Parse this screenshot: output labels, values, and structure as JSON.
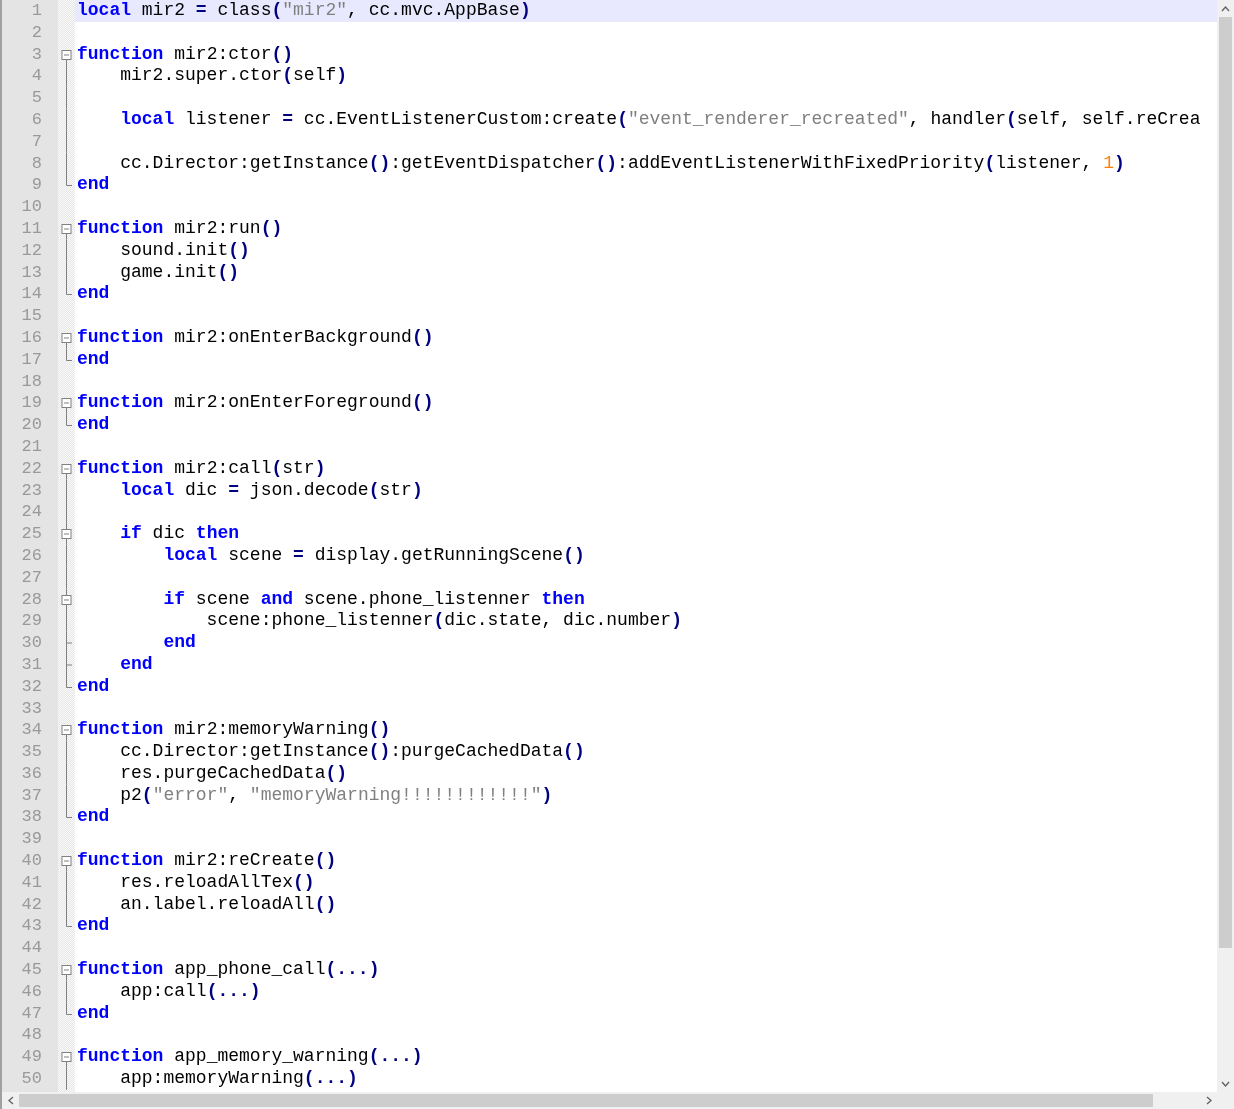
{
  "editor": {
    "lines": [
      {
        "number": "1",
        "kind": "plain",
        "current": true,
        "tokens": [
          {
            "kind": "keyword",
            "text": "local"
          },
          {
            "kind": "plain",
            "text": " mir2 "
          },
          {
            "kind": "operator",
            "text": "="
          },
          {
            "kind": "plain",
            "text": " class"
          },
          {
            "kind": "operator",
            "text": "("
          },
          {
            "kind": "string",
            "text": "\"mir2\""
          },
          {
            "kind": "plain",
            "text": ", cc.mvc.AppBase"
          },
          {
            "kind": "operator",
            "text": ")"
          }
        ]
      },
      {
        "number": "2",
        "kind": "plain",
        "current": false
      },
      {
        "number": "3",
        "kind": "fold-start",
        "current": false,
        "tokens": [
          {
            "kind": "keyword",
            "text": "function"
          },
          {
            "kind": "plain",
            "text": " mir2:ctor"
          },
          {
            "kind": "operator",
            "text": "()"
          }
        ]
      },
      {
        "number": "4",
        "kind": "fold-body",
        "current": false,
        "tokens": [
          {
            "kind": "plain",
            "text": "    mir2.super.ctor"
          },
          {
            "kind": "operator",
            "text": "("
          },
          {
            "kind": "plain",
            "text": "self"
          },
          {
            "kind": "operator",
            "text": ")"
          }
        ]
      },
      {
        "number": "5",
        "kind": "fold-body",
        "current": false
      },
      {
        "number": "6",
        "kind": "fold-body",
        "current": false,
        "tokens": [
          {
            "kind": "keyword",
            "text": "    local"
          },
          {
            "kind": "plain",
            "text": " listener "
          },
          {
            "kind": "operator",
            "text": "="
          },
          {
            "kind": "plain",
            "text": " cc.EventListenerCustom:create"
          },
          {
            "kind": "operator",
            "text": "("
          },
          {
            "kind": "string",
            "text": "\"event_renderer_recreated\""
          },
          {
            "kind": "plain",
            "text": ", handler"
          },
          {
            "kind": "operator",
            "text": "("
          },
          {
            "kind": "plain",
            "text": "self, self.reCrea"
          }
        ]
      },
      {
        "number": "7",
        "kind": "fold-body",
        "current": false
      },
      {
        "number": "8",
        "kind": "fold-body",
        "current": false,
        "tokens": [
          {
            "kind": "plain",
            "text": "    cc.Director:getInstance"
          },
          {
            "kind": "operator",
            "text": "()"
          },
          {
            "kind": "plain",
            "text": ":getEventDispatcher"
          },
          {
            "kind": "operator",
            "text": "()"
          },
          {
            "kind": "plain",
            "text": ":addEventListenerWithFixedPriority"
          },
          {
            "kind": "operator",
            "text": "("
          },
          {
            "kind": "plain",
            "text": "listener, "
          },
          {
            "kind": "number",
            "text": "1"
          },
          {
            "kind": "operator",
            "text": ")"
          }
        ]
      },
      {
        "number": "9",
        "kind": "fold-end",
        "current": false,
        "tokens": [
          {
            "kind": "keyword",
            "text": "end"
          }
        ]
      },
      {
        "number": "10",
        "kind": "plain",
        "current": false
      },
      {
        "number": "11",
        "kind": "fold-start",
        "current": false,
        "tokens": [
          {
            "kind": "keyword",
            "text": "function"
          },
          {
            "kind": "plain",
            "text": " mir2:run"
          },
          {
            "kind": "operator",
            "text": "()"
          }
        ]
      },
      {
        "number": "12",
        "kind": "fold-body",
        "current": false,
        "tokens": [
          {
            "kind": "plain",
            "text": "    sound.init"
          },
          {
            "kind": "operator",
            "text": "()"
          }
        ]
      },
      {
        "number": "13",
        "kind": "fold-body",
        "current": false,
        "tokens": [
          {
            "kind": "plain",
            "text": "    game.init"
          },
          {
            "kind": "operator",
            "text": "()"
          }
        ]
      },
      {
        "number": "14",
        "kind": "fold-end",
        "current": false,
        "tokens": [
          {
            "kind": "keyword",
            "text": "end"
          }
        ]
      },
      {
        "number": "15",
        "kind": "plain",
        "current": false
      },
      {
        "number": "16",
        "kind": "fold-start",
        "current": false,
        "tokens": [
          {
            "kind": "keyword",
            "text": "function"
          },
          {
            "kind": "plain",
            "text": " mir2:onEnterBackground"
          },
          {
            "kind": "operator",
            "text": "()"
          }
        ]
      },
      {
        "number": "17",
        "kind": "fold-end",
        "current": false,
        "tokens": [
          {
            "kind": "keyword",
            "text": "end"
          }
        ]
      },
      {
        "number": "18",
        "kind": "plain",
        "current": false
      },
      {
        "number": "19",
        "kind": "fold-start",
        "current": false,
        "tokens": [
          {
            "kind": "keyword",
            "text": "function"
          },
          {
            "kind": "plain",
            "text": " mir2:onEnterForeground"
          },
          {
            "kind": "operator",
            "text": "()"
          }
        ]
      },
      {
        "number": "20",
        "kind": "fold-end",
        "current": false,
        "tokens": [
          {
            "kind": "keyword",
            "text": "end"
          }
        ]
      },
      {
        "number": "21",
        "kind": "plain",
        "current": false
      },
      {
        "number": "22",
        "kind": "fold-start",
        "current": false,
        "tokens": [
          {
            "kind": "keyword",
            "text": "function"
          },
          {
            "kind": "plain",
            "text": " mir2:call"
          },
          {
            "kind": "operator",
            "text": "("
          },
          {
            "kind": "plain",
            "text": "str"
          },
          {
            "kind": "operator",
            "text": ")"
          }
        ]
      },
      {
        "number": "23",
        "kind": "fold-body",
        "current": false,
        "tokens": [
          {
            "kind": "keyword",
            "text": "    local"
          },
          {
            "kind": "plain",
            "text": " dic "
          },
          {
            "kind": "operator",
            "text": "="
          },
          {
            "kind": "plain",
            "text": " json.decode"
          },
          {
            "kind": "operator",
            "text": "("
          },
          {
            "kind": "plain",
            "text": "str"
          },
          {
            "kind": "operator",
            "text": ")"
          }
        ]
      },
      {
        "number": "24",
        "kind": "fold-body",
        "current": false
      },
      {
        "number": "25",
        "kind": "nested-fold-start",
        "current": false,
        "tokens": [
          {
            "kind": "keyword",
            "text": "    if"
          },
          {
            "kind": "plain",
            "text": " dic "
          },
          {
            "kind": "keyword",
            "text": "then"
          }
        ]
      },
      {
        "number": "26",
        "kind": "fold-body",
        "current": false,
        "tokens": [
          {
            "kind": "keyword",
            "text": "        local"
          },
          {
            "kind": "plain",
            "text": " scene "
          },
          {
            "kind": "operator",
            "text": "="
          },
          {
            "kind": "plain",
            "text": " display.getRunningScene"
          },
          {
            "kind": "operator",
            "text": "()"
          }
        ]
      },
      {
        "number": "27",
        "kind": "fold-body",
        "current": false
      },
      {
        "number": "28",
        "kind": "nested-fold-start",
        "current": false,
        "tokens": [
          {
            "kind": "keyword",
            "text": "        if"
          },
          {
            "kind": "plain",
            "text": " scene "
          },
          {
            "kind": "keyword",
            "text": "and"
          },
          {
            "kind": "plain",
            "text": " scene.phone_listenner "
          },
          {
            "kind": "keyword",
            "text": "then"
          }
        ]
      },
      {
        "number": "29",
        "kind": "fold-body",
        "current": false,
        "tokens": [
          {
            "kind": "plain",
            "text": "            scene:phone_listenner"
          },
          {
            "kind": "operator",
            "text": "("
          },
          {
            "kind": "plain",
            "text": "dic.state, dic.number"
          },
          {
            "kind": "operator",
            "text": ")"
          }
        ]
      },
      {
        "number": "30",
        "kind": "nested-fold-end",
        "current": false,
        "tokens": [
          {
            "kind": "keyword",
            "text": "        end"
          }
        ]
      },
      {
        "number": "31",
        "kind": "nested-fold-end",
        "current": false,
        "tokens": [
          {
            "kind": "keyword",
            "text": "    end"
          }
        ]
      },
      {
        "number": "32",
        "kind": "fold-end",
        "current": false,
        "tokens": [
          {
            "kind": "keyword",
            "text": "end"
          }
        ]
      },
      {
        "number": "33",
        "kind": "plain",
        "current": false
      },
      {
        "number": "34",
        "kind": "fold-start",
        "current": false,
        "tokens": [
          {
            "kind": "keyword",
            "text": "function"
          },
          {
            "kind": "plain",
            "text": " mir2:memoryWarning"
          },
          {
            "kind": "operator",
            "text": "()"
          }
        ]
      },
      {
        "number": "35",
        "kind": "fold-body",
        "current": false,
        "tokens": [
          {
            "kind": "plain",
            "text": "    cc.Director:getInstance"
          },
          {
            "kind": "operator",
            "text": "()"
          },
          {
            "kind": "plain",
            "text": ":purgeCachedData"
          },
          {
            "kind": "operator",
            "text": "()"
          }
        ]
      },
      {
        "number": "36",
        "kind": "fold-body",
        "current": false,
        "tokens": [
          {
            "kind": "plain",
            "text": "    res.purgeCachedData"
          },
          {
            "kind": "operator",
            "text": "()"
          }
        ]
      },
      {
        "number": "37",
        "kind": "fold-body",
        "current": false,
        "tokens": [
          {
            "kind": "plain",
            "text": "    p2"
          },
          {
            "kind": "operator",
            "text": "("
          },
          {
            "kind": "string",
            "text": "\"error\""
          },
          {
            "kind": "plain",
            "text": ", "
          },
          {
            "kind": "string",
            "text": "\"memoryWarning!!!!!!!!!!!!\""
          },
          {
            "kind": "operator",
            "text": ")"
          }
        ]
      },
      {
        "number": "38",
        "kind": "fold-end",
        "current": false,
        "tokens": [
          {
            "kind": "keyword",
            "text": "end"
          }
        ]
      },
      {
        "number": "39",
        "kind": "plain",
        "current": false
      },
      {
        "number": "40",
        "kind": "fold-start",
        "current": false,
        "tokens": [
          {
            "kind": "keyword",
            "text": "function"
          },
          {
            "kind": "plain",
            "text": " mir2:reCreate"
          },
          {
            "kind": "operator",
            "text": "()"
          }
        ]
      },
      {
        "number": "41",
        "kind": "fold-body",
        "current": false,
        "tokens": [
          {
            "kind": "plain",
            "text": "    res.reloadAllTex"
          },
          {
            "kind": "operator",
            "text": "()"
          }
        ]
      },
      {
        "number": "42",
        "kind": "fold-body",
        "current": false,
        "tokens": [
          {
            "kind": "plain",
            "text": "    an.label.reloadAll"
          },
          {
            "kind": "operator",
            "text": "()"
          }
        ]
      },
      {
        "number": "43",
        "kind": "fold-end",
        "current": false,
        "tokens": [
          {
            "kind": "keyword",
            "text": "end"
          }
        ]
      },
      {
        "number": "44",
        "kind": "plain",
        "current": false
      },
      {
        "number": "45",
        "kind": "fold-start",
        "current": false,
        "tokens": [
          {
            "kind": "keyword",
            "text": "function"
          },
          {
            "kind": "plain",
            "text": " app_phone_call"
          },
          {
            "kind": "operator",
            "text": "(...)"
          }
        ]
      },
      {
        "number": "46",
        "kind": "fold-body",
        "current": false,
        "tokens": [
          {
            "kind": "plain",
            "text": "    app:call"
          },
          {
            "kind": "operator",
            "text": "(...)"
          }
        ]
      },
      {
        "number": "47",
        "kind": "fold-end",
        "current": false,
        "tokens": [
          {
            "kind": "keyword",
            "text": "end"
          }
        ]
      },
      {
        "number": "48",
        "kind": "plain",
        "current": false
      },
      {
        "number": "49",
        "kind": "fold-start",
        "current": false,
        "tokens": [
          {
            "kind": "keyword",
            "text": "function"
          },
          {
            "kind": "plain",
            "text": " app_memory_warning"
          },
          {
            "kind": "operator",
            "text": "(...)"
          }
        ]
      },
      {
        "number": "50",
        "kind": "fold-body",
        "current": false,
        "tokens": [
          {
            "kind": "plain",
            "text": "    app:memoryWarning"
          },
          {
            "kind": "operator",
            "text": "(...)"
          }
        ]
      }
    ]
  }
}
